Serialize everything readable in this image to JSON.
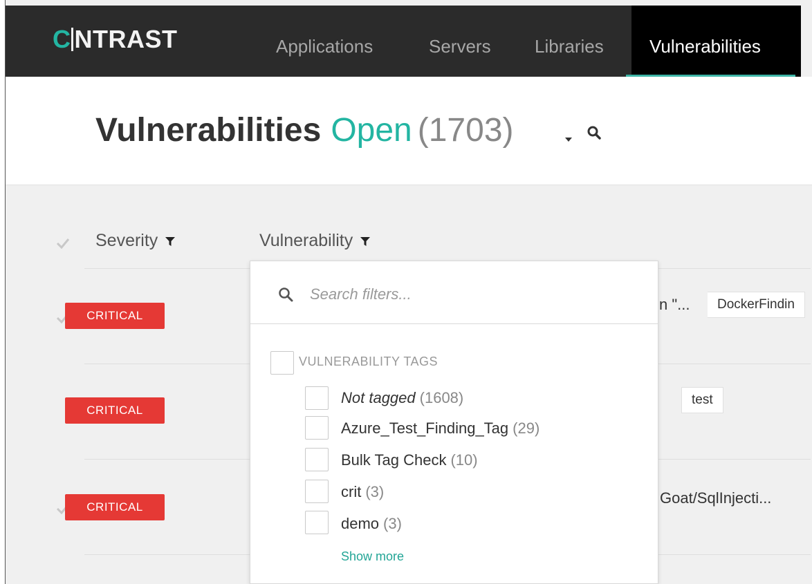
{
  "brand": {
    "logo_mark": "C",
    "logo_text": "NTRAST"
  },
  "nav": {
    "items": [
      {
        "label": "Applications"
      },
      {
        "label": "Servers"
      },
      {
        "label": "Libraries"
      },
      {
        "label": "Vulnerabilities",
        "active": true
      }
    ]
  },
  "page": {
    "title": "Vulnerabilities",
    "status": "Open",
    "count": "(1703)"
  },
  "table": {
    "columns": [
      {
        "label": "Severity"
      },
      {
        "label": "Vulnerability"
      }
    ],
    "rows": [
      {
        "severity": "CRITICAL",
        "partial_text": "n \"...",
        "tag": "DockerFindin"
      },
      {
        "severity": "CRITICAL",
        "partial_text": "",
        "tag": "test"
      },
      {
        "severity": "CRITICAL",
        "partial_text": "Goat/SqlInjecti...",
        "tag": ""
      }
    ]
  },
  "filter_dropdown": {
    "search_placeholder": "Search filters...",
    "group_label": "VULNERABILITY TAGS",
    "options": [
      {
        "name": "Not tagged",
        "count": "(1608)"
      },
      {
        "name": "Azure_Test_Finding_Tag",
        "count": "(29)"
      },
      {
        "name": "Bulk Tag Check",
        "count": "(10)"
      },
      {
        "name": "crit",
        "count": "(3)"
      },
      {
        "name": "demo",
        "count": "(3)"
      }
    ],
    "show_more": "Show more"
  },
  "colors": {
    "accent": "#23b5a2",
    "critical": "#e53935",
    "nav_bg": "#2b2b2b"
  }
}
